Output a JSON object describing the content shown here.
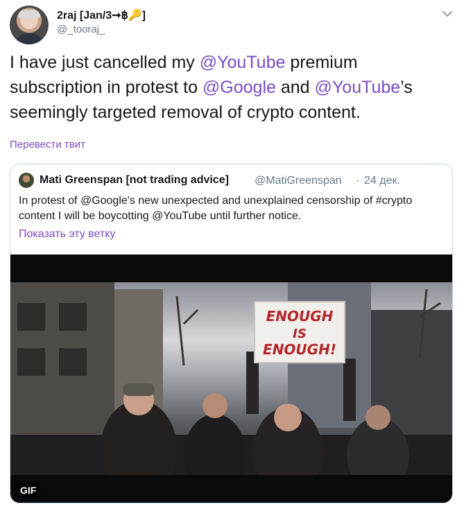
{
  "author": {
    "display_name": "2raj [Jan/3➞฿🔑]",
    "handle": "@_tooraj_"
  },
  "tweet": {
    "line1_pre": "I have just cancelled my ",
    "mention_youtube": "@YouTube",
    "line1_post": " premium subscription in protest to ",
    "mention_google": "@Google",
    "and": " and ",
    "mention_youtube2": "@YouTube",
    "tail": "’s seemingly targeted removal of crypto content."
  },
  "translate_label": "Перевести твит",
  "quoted": {
    "name": "Mati Greenspan [not trading advice]",
    "handle": "@MatiGreenspan",
    "separator": "·",
    "date": "24 дек.",
    "text": "In protest of @Google's new unexpected and unexplained censorship of #crypto content I will be boycotting @YouTube until further notice.",
    "thread_label": "Показать эту ветку"
  },
  "media": {
    "badge": "GIF",
    "sign_line1": "ENOUGH",
    "sign_line2": "IS",
    "sign_line3": "ENOUGH!"
  },
  "colors": {
    "link": "#794bc4",
    "muted": "#657786",
    "border": "#ccd6dd",
    "sign_text": "#b3262b"
  },
  "icons": {
    "caret": "chevron-down-icon"
  }
}
